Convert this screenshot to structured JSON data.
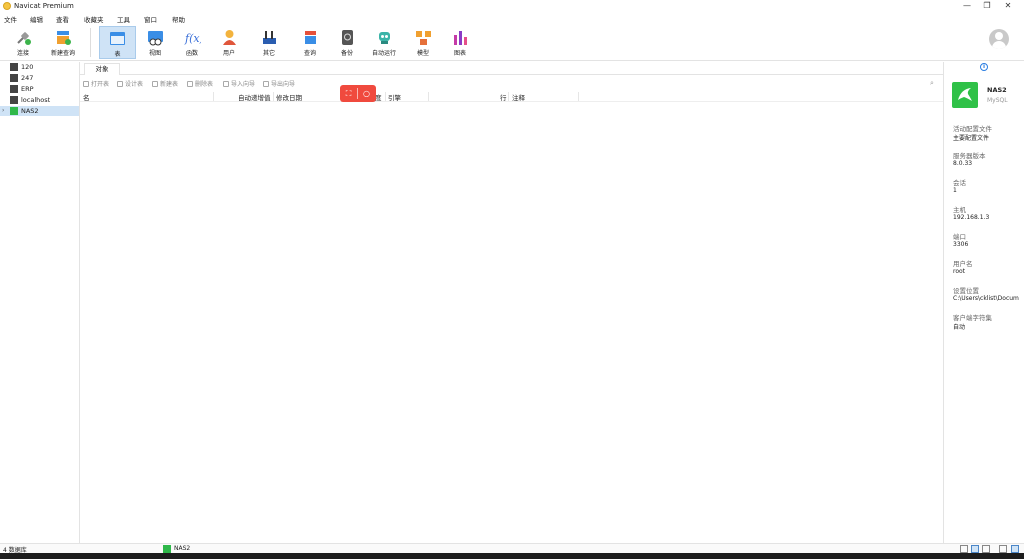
{
  "window": {
    "title": "Navicat Premium",
    "minimize": "—",
    "restore": "❐",
    "close": "✕"
  },
  "menu": [
    "文件",
    "编辑",
    "查看",
    "收藏夹",
    "工具",
    "窗口",
    "帮助"
  ],
  "toolbar": {
    "connect": "连接",
    "new_query": "新建查询",
    "table": "表",
    "view": "视图",
    "function": "函数",
    "user": "用户",
    "other": "其它",
    "query": "查询",
    "backup": "备份",
    "autorun": "自动运行",
    "model": "模型",
    "chart": "图表"
  },
  "connections": [
    "120",
    "247",
    "ERP",
    "localhost",
    "NAS2"
  ],
  "selected_connection": "NAS2",
  "tab": "对象",
  "object_toolbar": [
    "打开表",
    "设计表",
    "新建表",
    "删除表",
    "导入向导",
    "导出向导"
  ],
  "columns": [
    "名",
    "自动递增值",
    "修改日期",
    "数据长度",
    "引擎",
    "行",
    "注释"
  ],
  "columns_visible": {
    "name": "名",
    "auto_inc": "自动递增值",
    "modified": "修改日期",
    "data_len": "度",
    "engine": "引擎",
    "rows": "行",
    "comment": "注释"
  },
  "info_panel": {
    "name": "NAS2",
    "type": "MySQL",
    "props": [
      {
        "label": "活动配置文件",
        "value": "主要配置文件"
      },
      {
        "label": "服务器版本",
        "value": "8.0.33"
      },
      {
        "label": "会话",
        "value": "1"
      },
      {
        "label": "主机",
        "value": "192.168.1.3"
      },
      {
        "label": "端口",
        "value": "3306"
      },
      {
        "label": "用户名",
        "value": "root"
      },
      {
        "label": "设置位置",
        "value": "C:\\Users\\cklist\\Docum"
      },
      {
        "label": "客户端字符集",
        "value": "自动"
      }
    ]
  },
  "status": {
    "db_count": "4 数据库",
    "connection": "NAS2"
  },
  "colors": {
    "accent": "#cfe3f6",
    "mysql_green": "#2fc147",
    "float_red": "#f04a3e"
  }
}
